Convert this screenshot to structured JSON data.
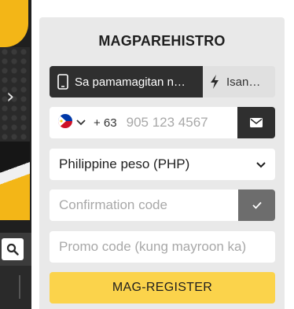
{
  "modal": {
    "title": "MAGPAREHISTRO",
    "tabs": [
      {
        "label": "Sa pamamagitan n…",
        "icon": "phone-icon",
        "active": true
      },
      {
        "label": "Isan…",
        "icon": "lightning-icon",
        "active": false
      }
    ],
    "phone": {
      "country_flag": "philippines-flag-icon",
      "dial_code": "+ 63",
      "placeholder": "905 123 4567",
      "action_icon": "envelope-icon"
    },
    "currency": {
      "selected": "Philippine peso (PHP)"
    },
    "confirmation": {
      "placeholder": "Confirmation code",
      "action_icon": "checkmark-icon"
    },
    "promo": {
      "placeholder": "Promo code (kung mayroon ka)"
    },
    "register_label": "MAG-REGISTER"
  },
  "colors": {
    "accent": "#fbd34b",
    "dark": "#2f2f2f",
    "panel": "#e9e9e9"
  }
}
